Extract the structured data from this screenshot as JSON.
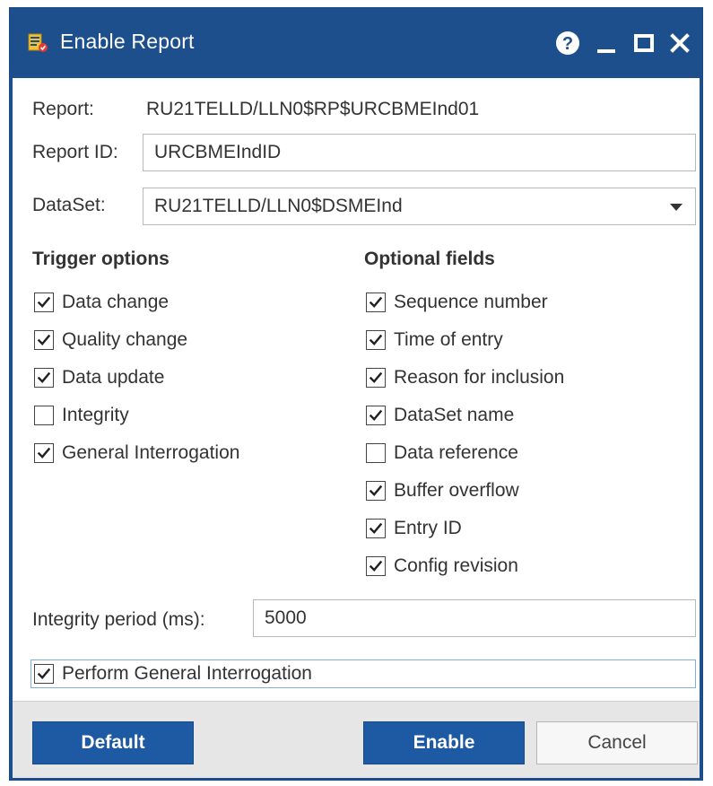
{
  "window": {
    "title": "Enable Report",
    "titlebar_color": "#1d4f8c",
    "controls": [
      "help-icon",
      "minimize-icon",
      "maximize-icon",
      "close-icon"
    ]
  },
  "report": {
    "label": "Report:",
    "value": "RU21TELLD/LLN0$RP$URCBMEInd01"
  },
  "report_id": {
    "label": "Report ID:",
    "value": "URCBMEIndID"
  },
  "dataset": {
    "label": "DataSet:",
    "selected": "RU21TELLD/LLN0$DSMEInd"
  },
  "trigger_options": {
    "heading": "Trigger options",
    "items": [
      {
        "label": "Data change",
        "checked": true
      },
      {
        "label": "Quality change",
        "checked": true
      },
      {
        "label": "Data update",
        "checked": true
      },
      {
        "label": "Integrity",
        "checked": false
      },
      {
        "label": "General Interrogation",
        "checked": true
      }
    ]
  },
  "optional_fields": {
    "heading": "Optional fields",
    "items": [
      {
        "label": "Sequence number",
        "checked": true
      },
      {
        "label": "Time of entry",
        "checked": true
      },
      {
        "label": "Reason for inclusion",
        "checked": true
      },
      {
        "label": "DataSet name",
        "checked": true
      },
      {
        "label": "Data reference",
        "checked": false
      },
      {
        "label": "Buffer overflow",
        "checked": true
      },
      {
        "label": "Entry ID",
        "checked": true
      },
      {
        "label": "Config revision",
        "checked": true
      }
    ]
  },
  "integrity_period": {
    "label": "Integrity period (ms):",
    "value": "5000"
  },
  "perform_gi": {
    "label": "Perform General Interrogation",
    "checked": true
  },
  "buttons": {
    "default": "Default",
    "enable": "Enable",
    "cancel": "Cancel"
  },
  "colors": {
    "accent": "#1d5aa3",
    "footer": "#e6e6e6"
  }
}
